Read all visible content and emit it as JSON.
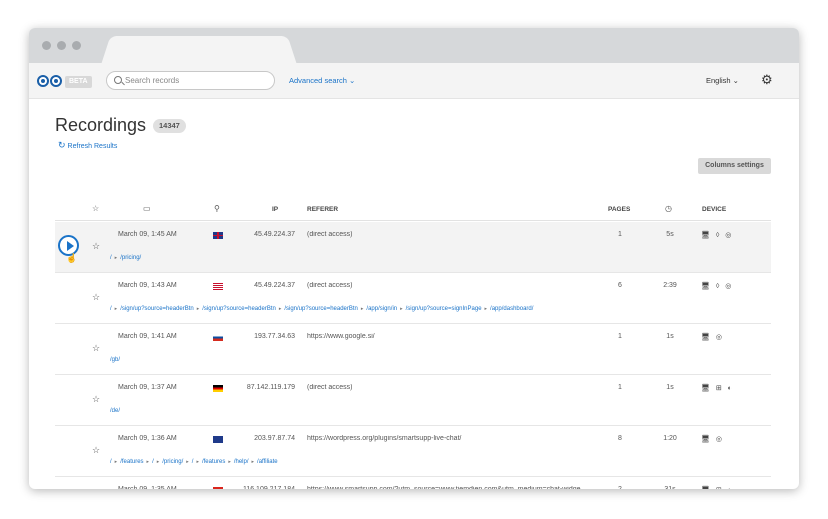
{
  "header": {
    "beta_label": "BETA",
    "search_placeholder": "Search records",
    "advanced_search": "Advanced search ⌄",
    "language": "English ⌄"
  },
  "page": {
    "title": "Recordings",
    "count": "14347",
    "refresh": "Refresh Results",
    "columns_settings": "Columns settings"
  },
  "table": {
    "headers": {
      "ip": "IP",
      "referer": "REFERER",
      "pages": "PAGES",
      "device": "DEVICE"
    },
    "header_icons": [
      "star-icon",
      "calendar-icon",
      "location-pin-icon",
      "clock-icon"
    ],
    "rows": [
      {
        "date": "March 09, 1:45 AM",
        "flag": "gb",
        "ip": "45.49.224.37",
        "referer": "(direct access)",
        "pages": "1",
        "duration": "5s",
        "devices": "🖥 ◊ ◎",
        "path": [
          "/",
          "/pricing/"
        ]
      },
      {
        "date": "March 09, 1:43 AM",
        "flag": "us",
        "ip": "45.49.224.37",
        "referer": "(direct access)",
        "pages": "6",
        "duration": "2:39",
        "devices": "🖥 ◊ ◎",
        "path": [
          "/",
          "/sign/up?source=headerBtn",
          "/sign/up?source=headerBtn",
          "/sign/up?source=headerBtn",
          "/app/sign/in",
          "/sign/up?source=signInPage",
          "/app/dashboard/"
        ]
      },
      {
        "date": "March 09, 1:41 AM",
        "flag": "si",
        "ip": "193.77.34.63",
        "referer": "https://www.google.si/",
        "pages": "1",
        "duration": "1s",
        "devices": "🖥  ◎",
        "path": [
          "/gb/"
        ]
      },
      {
        "date": "March 09, 1:37 AM",
        "flag": "de",
        "ip": "87.142.119.179",
        "referer": "(direct access)",
        "pages": "1",
        "duration": "1s",
        "devices": "🖥 ⊞ ◐",
        "path": [
          "/de/"
        ]
      },
      {
        "date": "March 09, 1:36 AM",
        "flag": "au",
        "ip": "203.97.87.74",
        "referer": "https://wordpress.org/plugins/smartsupp-live-chat/",
        "pages": "8",
        "duration": "1:20",
        "devices": "🖥  ◎",
        "path": [
          "/",
          "/features",
          "/",
          "/pricing/",
          "/",
          "/features",
          "/help/",
          "/affiliate"
        ]
      },
      {
        "date": "March 09, 1:35 AM",
        "flag": "vn",
        "ip": "116.109.217.184",
        "referer": "https://www.smartsupp.com/?utm_source=www.tiemdien.com&utm_medium=chat-widge",
        "pages": "2",
        "duration": "31s",
        "devices": "🖥 ⊞ ◐",
        "path": []
      }
    ]
  }
}
